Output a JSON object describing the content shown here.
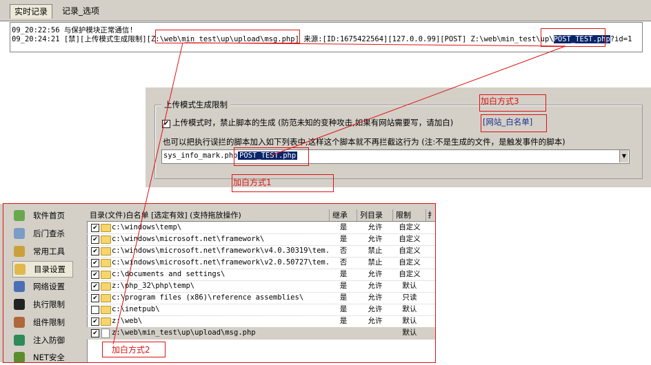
{
  "tabs": [
    "实时记录",
    "记录_选项"
  ],
  "log": {
    "line1": "09_20:22:56 与保护模块正常通信!",
    "line2_prefix": "09_20:24:21 [禁][上传模式生成限制][Z:\\web\\min_test\\up\\upload\\msg.php] 来源:[ID:1675422564][127.0.0.99][POST] Z:\\web\\min_test\\up\\",
    "line2_selected": "POST_TEST.php",
    "line2_suffix": "?id=1"
  },
  "upload": {
    "group_title": "上传模式生成限制",
    "checkbox_label": "上传模式时，禁止脚本的生成 (防范未知的变种攻击,如果有网站需要写，请加白)",
    "whitelist_link": "[网站_白名单]",
    "hint": "也可以把执行误拦的脚本加入如下列表中,这样这个脚本就不再拦截这行为 (注:不是生成的文件，是触发事件的脚本)",
    "input_value_prefix": "sys_info_mark.php",
    "input_value_selected": "POST_TEST.php"
  },
  "annotations": {
    "method1": "加白方式1",
    "method2": "加白方式2",
    "method3": "加白方式3"
  },
  "nav": [
    {
      "label": "软件首页",
      "icon": "home-icon",
      "color": "#6aa84f"
    },
    {
      "label": "后门查杀",
      "icon": "scan-icon",
      "color": "#7b9cc4"
    },
    {
      "label": "常用工具",
      "icon": "toolbox-icon",
      "color": "#c9a13b"
    },
    {
      "label": "目录设置",
      "icon": "folder-settings-icon",
      "color": "#e0b84c"
    },
    {
      "label": "网络设置",
      "icon": "network-icon",
      "color": "#4a6fb5"
    },
    {
      "label": "执行限制",
      "icon": "terminal-icon",
      "color": "#222222"
    },
    {
      "label": "组件限制",
      "icon": "component-icon",
      "color": "#b0683a"
    },
    {
      "label": "注入防御",
      "icon": "globe-icon",
      "color": "#2f8a5a"
    },
    {
      "label": "NET安全",
      "icon": "net-security-icon",
      "color": "#5e8c2d"
    }
  ],
  "table": {
    "headers": [
      "目录(文件)白名单 [选定有效]  (支持拖放操作)",
      "继承",
      "列目录",
      "限制",
      "扌"
    ],
    "rows": [
      {
        "checked": true,
        "type": "folder",
        "path": "c:\\windows\\temp\\",
        "inherit": "是",
        "list": "允许",
        "limit": "自定义"
      },
      {
        "checked": true,
        "type": "folder",
        "path": "c:\\windows\\microsoft.net\\framework\\",
        "inherit": "是",
        "list": "允许",
        "limit": "自定义"
      },
      {
        "checked": true,
        "type": "folder",
        "path": "c:\\windows\\microsoft.net\\framework\\v4.0.30319\\tem...",
        "inherit": "否",
        "list": "禁止",
        "limit": "自定义"
      },
      {
        "checked": true,
        "type": "folder",
        "path": "c:\\windows\\microsoft.net\\framework\\v2.0.50727\\tem...",
        "inherit": "否",
        "list": "禁止",
        "limit": "自定义"
      },
      {
        "checked": true,
        "type": "folder",
        "path": "c:\\documents and settings\\",
        "inherit": "是",
        "list": "允许",
        "limit": "自定义"
      },
      {
        "checked": true,
        "type": "folder",
        "path": "z:\\php_32\\php\\temp\\",
        "inherit": "是",
        "list": "允许",
        "limit": "默认"
      },
      {
        "checked": true,
        "type": "folder",
        "path": "c:\\program files (x86)\\reference assemblies\\",
        "inherit": "是",
        "list": "允许",
        "limit": "只读"
      },
      {
        "checked": false,
        "type": "folder",
        "path": "c:\\inetpub\\",
        "inherit": "是",
        "list": "允许",
        "limit": "默认"
      },
      {
        "checked": true,
        "type": "folder",
        "path": "z:\\web\\",
        "inherit": "是",
        "list": "允许",
        "limit": "默认"
      },
      {
        "checked": true,
        "type": "file",
        "path": "z:\\web\\min_test\\up\\upload\\msg.php",
        "inherit": "",
        "list": "",
        "limit": "默认"
      }
    ]
  },
  "colors": {
    "annotation": "#dd1111",
    "selection": "#0a246a",
    "panel": "#d4d0c8"
  }
}
